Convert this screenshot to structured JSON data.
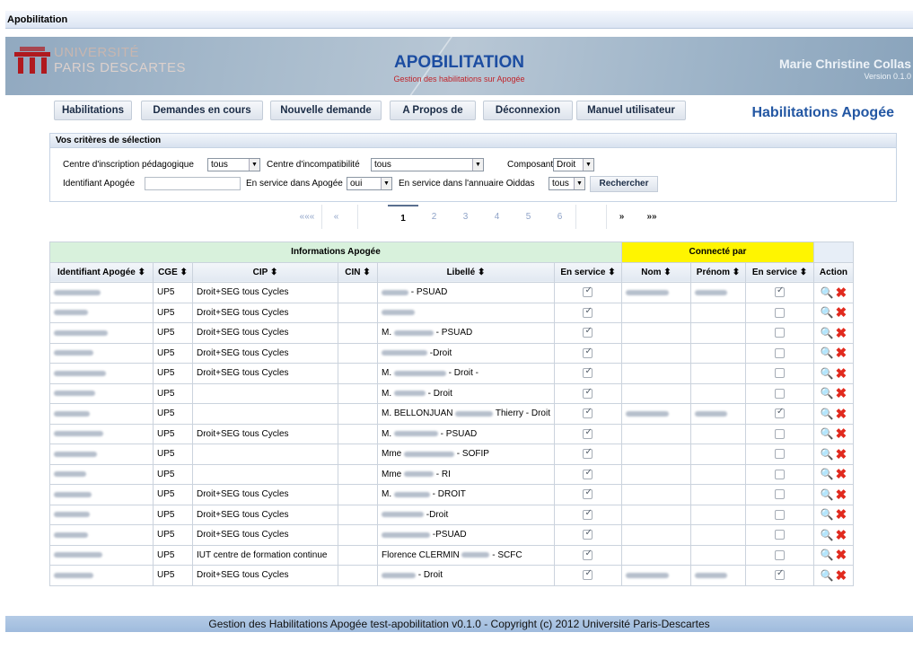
{
  "window": {
    "title": "Apobilitation"
  },
  "banner": {
    "university_line1": "UNIVERSITÉ",
    "university_line2": "PARIS DESCARTES",
    "app_title": "APOBILITATION",
    "app_subtitle": "Gestion des habilitations sur Apogée",
    "user_name": "Marie Christine Collas",
    "version": "Version 0.1.0"
  },
  "nav": {
    "items": [
      "Habilitations",
      "Demandes en cours",
      "Nouvelle demande",
      "A Propos de",
      "Déconnexion",
      "Manuel utilisateur"
    ],
    "page_heading": "Habilitations Apogée"
  },
  "criteria": {
    "title": "Vos critères de sélection",
    "centre_label": "Centre d'inscription pédagogique",
    "centre_value": "tous",
    "incompat_label": "Centre d'incompatibilité",
    "incompat_value": "tous",
    "composante_label": "Composante",
    "composante_value": "Droit",
    "ident_label": "Identifiant Apogée",
    "ident_value": "",
    "service_apogee_label": "En service dans Apogée",
    "service_apogee_value": "oui",
    "service_annuaire_label": "En service dans l'annuaire Oiddas",
    "service_annuaire_value": "tous",
    "search_label": "Rechercher"
  },
  "pager": {
    "first": "«««",
    "prev": "«",
    "pages": [
      "1",
      "2",
      "3",
      "4",
      "5",
      "6"
    ],
    "current": "1",
    "next": "»",
    "last": "»»"
  },
  "table": {
    "group_info": "Informations Apogée",
    "group_conn": "Connecté par",
    "headers": [
      "Identifiant Apogée ⬍",
      "CGE ⬍",
      "CIP ⬍",
      "CIN ⬍",
      "Libellé ⬍",
      "En service ⬍",
      "Nom ⬍",
      "Prénom ⬍",
      "En service ⬍",
      "Action"
    ],
    "rows": [
      {
        "cge": "UP5",
        "cip": "Droit+SEG tous Cycles",
        "libelle_suffix": "- PSUAD",
        "svc": true,
        "conn": true,
        "conn_svc": true
      },
      {
        "cge": "UP5",
        "cip": "Droit+SEG tous Cycles",
        "libelle_suffix": "",
        "svc": true,
        "conn": false,
        "conn_svc": false
      },
      {
        "cge": "UP5",
        "cip": "Droit+SEG tous Cycles",
        "libelle_prefix": "M.",
        "libelle_suffix": "- PSUAD",
        "svc": true,
        "conn": false,
        "conn_svc": false
      },
      {
        "cge": "UP5",
        "cip": "Droit+SEG tous Cycles",
        "libelle_suffix": "-Droit",
        "svc": true,
        "conn": false,
        "conn_svc": false
      },
      {
        "cge": "UP5",
        "cip": "Droit+SEG tous Cycles",
        "libelle_prefix": "M.",
        "libelle_suffix": "- Droit -",
        "svc": true,
        "conn": false,
        "conn_svc": false
      },
      {
        "cge": "UP5",
        "cip": "",
        "libelle_prefix": "M.",
        "libelle_suffix": "- Droit",
        "svc": true,
        "conn": false,
        "conn_svc": false
      },
      {
        "cge": "UP5",
        "cip": "",
        "libelle_prefix": "M. BELLONJUAN",
        "libelle_suffix": "Thierry - Droit",
        "svc": true,
        "conn": true,
        "conn_svc": true
      },
      {
        "cge": "UP5",
        "cip": "Droit+SEG tous Cycles",
        "libelle_prefix": "M.",
        "libelle_suffix": "- PSUAD",
        "svc": true,
        "conn": false,
        "conn_svc": false
      },
      {
        "cge": "UP5",
        "cip": "",
        "libelle_prefix": "Mme",
        "libelle_suffix": "- SOFIP",
        "svc": true,
        "conn": false,
        "conn_svc": false
      },
      {
        "cge": "UP5",
        "cip": "",
        "libelle_prefix": "Mme",
        "libelle_suffix": "- RI",
        "svc": true,
        "conn": false,
        "conn_svc": false
      },
      {
        "cge": "UP5",
        "cip": "Droit+SEG tous Cycles",
        "libelle_prefix": "M.",
        "libelle_suffix": "- DROIT",
        "svc": true,
        "conn": false,
        "conn_svc": false
      },
      {
        "cge": "UP5",
        "cip": "Droit+SEG tous Cycles",
        "libelle_suffix": "-Droit",
        "svc": true,
        "conn": false,
        "conn_svc": false
      },
      {
        "cge": "UP5",
        "cip": "Droit+SEG tous Cycles",
        "libelle_suffix": "-PSUAD",
        "svc": true,
        "conn": false,
        "conn_svc": false
      },
      {
        "cge": "UP5",
        "cip": "IUT centre de formation continue",
        "libelle_prefix": "Florence CLERMIN",
        "libelle_suffix": "- SCFC",
        "svc": true,
        "conn": false,
        "conn_svc": false
      },
      {
        "cge": "UP5",
        "cip": "Droit+SEG tous Cycles",
        "libelle_suffix": "- Droit",
        "svc": true,
        "conn": true,
        "conn_svc": true
      }
    ]
  },
  "footer": {
    "text": "Gestion des Habilitations Apogée test-apobilitation v0.1.0 - Copyright (c) 2012 Université Paris-Descartes"
  },
  "icons": {
    "view": "magnifier-icon",
    "delete": "red-x-icon"
  },
  "colors": {
    "title_blue": "#1c4da1",
    "heading_blue": "#2357a3",
    "info_green": "#d8f1dc",
    "conn_yellow": "#fff500",
    "delete_red": "#e12a1e"
  }
}
